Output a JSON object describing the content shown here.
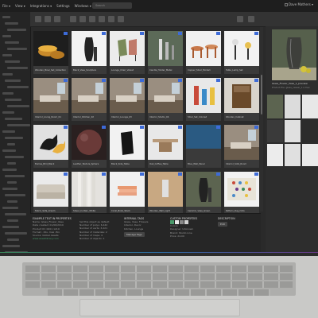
{
  "menubar": {
    "items": [
      "File ▾",
      "View ▾",
      "Integrations ▾",
      "Settings",
      "Windows ▾",
      "Help ▾"
    ],
    "search_placeholder": "Search",
    "user": "Dave Mathers ▾"
  },
  "grid": {
    "items": [
      {
        "caption": "Wooden_Bowl_Set_Collection",
        "bg": "#1e1e1e",
        "icon": "bowls"
      },
      {
        "caption": "Black_Vase_Sculpture",
        "bg": "#f2f2f2",
        "icon": "vase"
      },
      {
        "caption": "Lounge_Chair_Velvet",
        "bg": "#ececec",
        "icon": "chair"
      },
      {
        "caption": "Candle_Holder_Metal",
        "bg": "#5c6a58",
        "icon": "candles"
      },
      {
        "caption": "Copper_Stool_Modern",
        "bg": "#f0f0f0",
        "icon": "stool"
      },
      {
        "caption": "Table_Lamp_Set",
        "bg": "#f2f2f2",
        "icon": "lamps"
      },
      {
        "caption": "Interior_Living_Room_01",
        "bg": "#6b5a48",
        "icon": "room"
      },
      {
        "caption": "Interior_Kitchen_02",
        "bg": "#8a8478",
        "icon": "room"
      },
      {
        "caption": "Interior_Lounge_03",
        "bg": "#7c7268",
        "icon": "room"
      },
      {
        "caption": "Interior_Studio_04",
        "bg": "#6c645c",
        "icon": "room"
      },
      {
        "caption": "Stool_Set_Colored",
        "bg": "#e8e8e8",
        "icon": "stools"
      },
      {
        "caption": "Wooden_Cabinet",
        "bg": "#d8d4cc",
        "icon": "cabinet"
      },
      {
        "caption": "Eames_Bird_Black",
        "bg": "#e0e0e0",
        "icon": "bird"
      },
      {
        "caption": "Leather_Texture_Sphere",
        "bg": "#2a2020",
        "icon": "sphere"
      },
      {
        "caption": "Black_Side_Table",
        "bg": "#f2f2f2",
        "icon": "box"
      },
      {
        "caption": "Oak_Coffee_Table",
        "bg": "#e8e8e8",
        "icon": "table"
      },
      {
        "caption": "Blue_Wall_Panel",
        "bg": "#3a6a90",
        "icon": "wall"
      },
      {
        "caption": "Interior_Sofa_Room",
        "bg": "#8a8078",
        "icon": "room"
      },
      {
        "caption": "Fabric_Sofa_Cream",
        "bg": "#eaeaea",
        "icon": "sofa"
      },
      {
        "caption": "Sheer_Curtain_White",
        "bg": "#e4e2de",
        "icon": "curtain"
      },
      {
        "caption": "Coral_Book_Stack",
        "bg": "#f0f0f0",
        "icon": "books"
      },
      {
        "caption": "Wooden_Wall_Light",
        "bg": "#c8a882",
        "icon": "wood"
      },
      {
        "caption": "Ceramic_Vase_Green",
        "bg": "#5c6450",
        "icon": "vase"
      },
      {
        "caption": "Pattern_Rug_Dots",
        "bg": "#f2f2f2",
        "icon": "rug"
      }
    ]
  },
  "right_pane": {
    "title": "Glass_Flower_Vase_1_preview",
    "subtitle": "Product file: glass_vessel_1.x.max",
    "thumbs": [
      "#5c6450",
      "#dcdcdc",
      "#e8e8e8",
      "#3a3a3a",
      "#e0e0e0",
      "#2c2c2c",
      "#ececec",
      "#e0e0e0",
      "#eaeaea"
    ]
  },
  "bottom": {
    "col1_title": "EXAMPLE TEXT IN PROPERTIES",
    "col1_lines": [
      "Name: Glass_Flower_Vase",
      "Date created: 01/06/2019",
      "Product ID: 0001 1219",
      "Format: .3ds .max .fbx",
      "Source: Global Assets"
    ],
    "col1_link": "www.assetlibrary.com",
    "col2_lines": [
      "Set this object as default",
      "Number of polys: 6,442",
      "Number of verts: 3,221",
      "Number of materials: 2",
      "Number of maps: 4",
      "Number of objects: 1"
    ],
    "col3_title": "INTERNAL TAGS",
    "col3_lines": [
      "Glass, Vase, Flowers",
      "Interior, Decor",
      "Kitchen, Lounge"
    ],
    "col3_button": "Manage Tags",
    "col4_title": "CUSTOM PROPERTIES",
    "col4_lines": [
      "Colors:",
      "Designer: Unknown",
      "Brand: Studio Line",
      "Price: 24.00"
    ],
    "col5_title": "DESCRIPTION",
    "col5_button": "Edit",
    "swatches": [
      "#4a9a6b",
      "#eaeaea",
      "#888888",
      "#cfcfcf"
    ]
  }
}
